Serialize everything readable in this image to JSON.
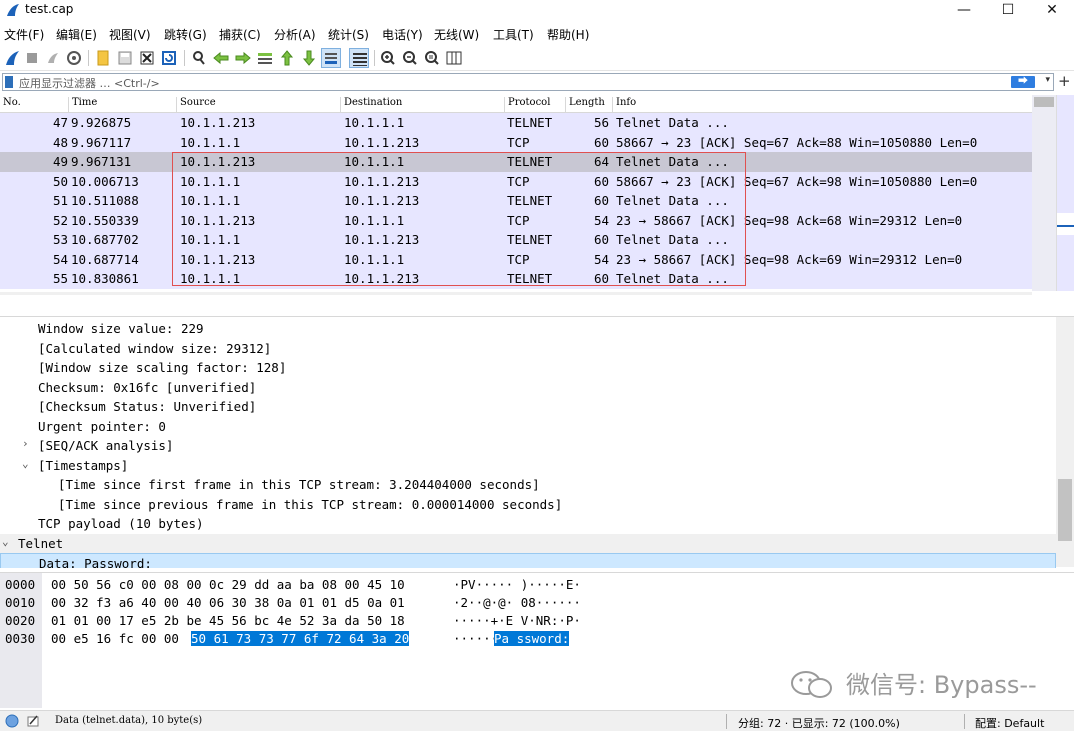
{
  "window": {
    "title": "test.cap",
    "controls": [
      "—",
      "☐",
      "✕"
    ]
  },
  "menu": [
    "文件(F)",
    "编辑(E)",
    "视图(V)",
    "跳转(G)",
    "捕获(C)",
    "分析(A)",
    "统计(S)",
    "电话(Y)",
    "无线(W)",
    "工具(T)",
    "帮助(H)"
  ],
  "toolbar_icons": [
    "shark-fin-start-icon",
    "stop-icon",
    "restart-icon",
    "capture-options-icon",
    "open-file-icon",
    "save-file-icon",
    "close-file-icon",
    "reload-icon",
    "find-icon",
    "back-icon",
    "forward-icon",
    "goto-packet-icon",
    "first-packet-icon",
    "last-packet-icon",
    "autoscroll-icon",
    "colorize-icon",
    "zoom-in-icon",
    "zoom-out-icon",
    "normal-size-icon",
    "resize-columns-icon"
  ],
  "filter": {
    "placeholder": "应用显示过滤器 … <Ctrl-/>",
    "apply_label": "⮕",
    "dropdown": "▾",
    "add": "+"
  },
  "packet_list": {
    "columns": [
      "No.",
      "Time",
      "Source",
      "Destination",
      "Protocol",
      "Length",
      "Info"
    ],
    "rows": [
      {
        "no": "47",
        "time": "9.926875",
        "src": "10.1.1.213",
        "dst": "10.1.1.1",
        "proto": "TELNET",
        "len": "56",
        "info": "Telnet Data ..."
      },
      {
        "no": "48",
        "time": "9.967117",
        "src": "10.1.1.1",
        "dst": "10.1.1.213",
        "proto": "TCP",
        "len": "60",
        "info": "58667 → 23 [ACK] Seq=67 Ack=88 Win=1050880 Len=0"
      },
      {
        "no": "49",
        "time": "9.967131",
        "src": "10.1.1.213",
        "dst": "10.1.1.1",
        "proto": "TELNET",
        "len": "64",
        "info": "Telnet Data ..."
      },
      {
        "no": "50",
        "time": "10.006713",
        "src": "10.1.1.1",
        "dst": "10.1.1.213",
        "proto": "TCP",
        "len": "60",
        "info": "58667 → 23 [ACK] Seq=67 Ack=98 Win=1050880 Len=0"
      },
      {
        "no": "51",
        "time": "10.511088",
        "src": "10.1.1.1",
        "dst": "10.1.1.213",
        "proto": "TELNET",
        "len": "60",
        "info": "Telnet Data ..."
      },
      {
        "no": "52",
        "time": "10.550339",
        "src": "10.1.1.213",
        "dst": "10.1.1.1",
        "proto": "TCP",
        "len": "54",
        "info": "23 → 58667 [ACK] Seq=98 Ack=68 Win=29312 Len=0"
      },
      {
        "no": "53",
        "time": "10.687702",
        "src": "10.1.1.1",
        "dst": "10.1.1.213",
        "proto": "TELNET",
        "len": "60",
        "info": "Telnet Data ..."
      },
      {
        "no": "54",
        "time": "10.687714",
        "src": "10.1.1.213",
        "dst": "10.1.1.1",
        "proto": "TCP",
        "len": "54",
        "info": "23 → 58667 [ACK] Seq=98 Ack=69 Win=29312 Len=0"
      },
      {
        "no": "55",
        "time": "10.830861",
        "src": "10.1.1.1",
        "dst": "10.1.1.213",
        "proto": "TELNET",
        "len": "60",
        "info": "Telnet Data ..."
      }
    ],
    "selected_no": "49",
    "row_bg": "#e7e6ff",
    "selected_bg": "#c8c7d3",
    "scroll_left": "‹",
    "scroll_right": "›"
  },
  "details": [
    {
      "text": "Window size value: 229",
      "arrow": ""
    },
    {
      "text": "[Calculated window size: 29312]",
      "arrow": ""
    },
    {
      "text": "[Window size scaling factor: 128]",
      "arrow": ""
    },
    {
      "text": "Checksum: 0x16fc [unverified]",
      "arrow": ""
    },
    {
      "text": "[Checksum Status: Unverified]",
      "arrow": ""
    },
    {
      "text": "Urgent pointer: 0",
      "arrow": ""
    },
    {
      "text": "[SEQ/ACK analysis]",
      "arrow": "›"
    },
    {
      "text": "[Timestamps]",
      "arrow": "⌄"
    },
    {
      "text": "[Time since first frame in this TCP stream: 3.204404000 seconds]",
      "arrow": ""
    },
    {
      "text": "[Time since previous frame in this TCP stream: 0.000014000 seconds]",
      "arrow": ""
    },
    {
      "text": "TCP payload (10 bytes)",
      "arrow": ""
    },
    {
      "text": "Telnet",
      "arrow": "⌄"
    },
    {
      "text": "Data: Password:",
      "arrow": ""
    }
  ],
  "hex": [
    {
      "off": "0000",
      "bytes": "00 50 56 c0 00 08 00 0c  29 dd aa ba 08 00 45 10",
      "ascii": "·PV····· )·····E·"
    },
    {
      "off": "0010",
      "bytes": "00 32 f3 a6 40 00 40 06  30 38 0a 01 01 d5 0a 01",
      "ascii": "·2··@·@· 08······"
    },
    {
      "off": "0020",
      "bytes": "01 01 00 17 e5 2b be 45  56 bc 4e 52 3a da 50 18",
      "ascii": "·····+·E V·NR:·P·"
    },
    {
      "off": "0030",
      "bytes_plain": "00 e5 16 fc 00 00",
      "bytes_sel": "50 61  73 73 77 6f 72 64 3a 20",
      "ascii_plain": "······",
      "ascii_sel": "Pa ssword: "
    }
  ],
  "watermark": "微信号: Bypass--",
  "status": {
    "field": "Data (telnet.data), 10 byte(s)",
    "packets": "分组: 72 · 已显示: 72 (100.0%)",
    "profile": "配置: Default"
  }
}
